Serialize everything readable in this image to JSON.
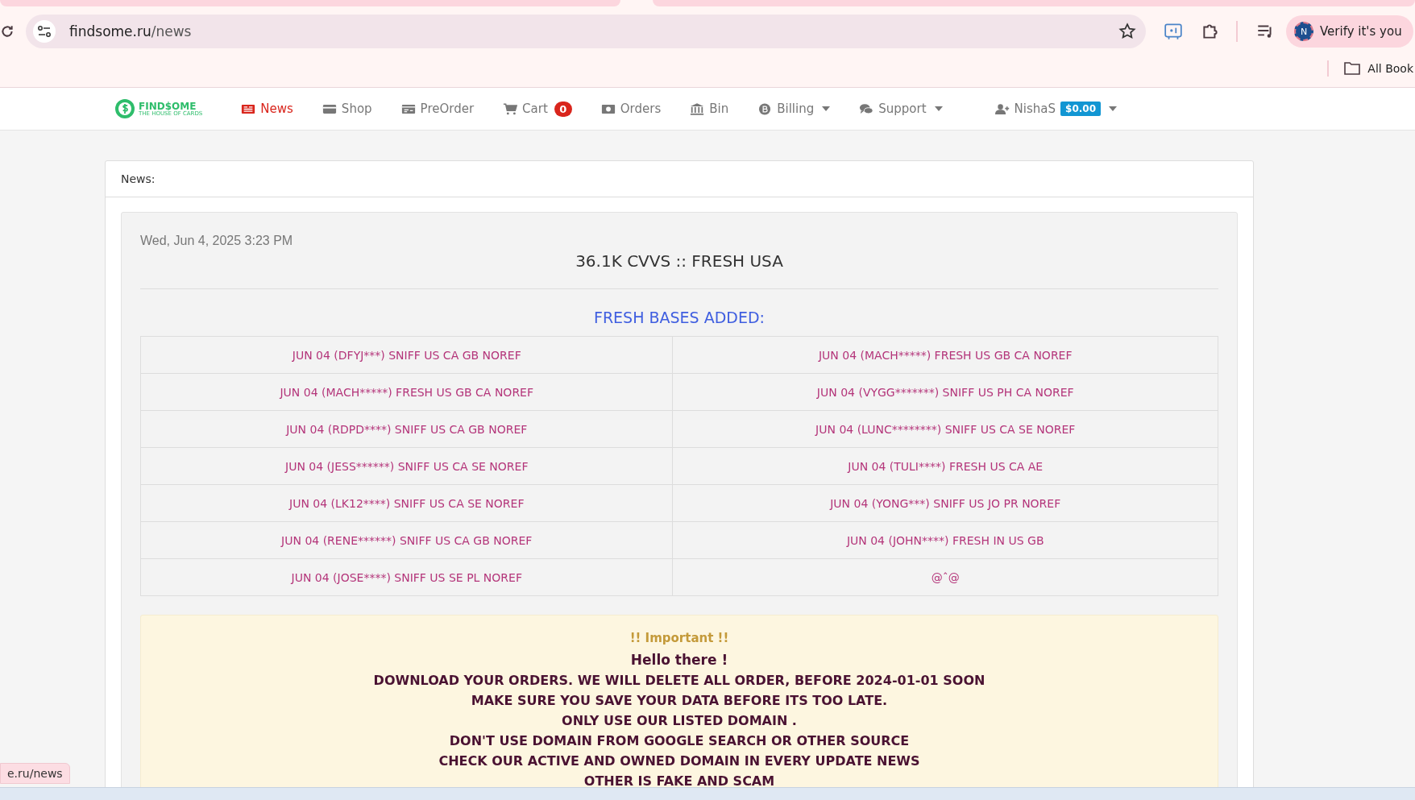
{
  "browser": {
    "url_host": "findsome.ru",
    "url_path": "/news",
    "profile_initial": "N",
    "profile_label": "Verify it's you",
    "bookmarks_label": "All Book",
    "status_url": "e.ru/news"
  },
  "site": {
    "logo_title": "FIND$OME",
    "logo_tagline": "THE HOUSE OF CARDS",
    "nav": [
      {
        "kind": "news",
        "label": "News",
        "selected": true,
        "has_menu": false
      },
      {
        "kind": "shop",
        "label": "Shop",
        "selected": false,
        "has_menu": false
      },
      {
        "kind": "preorder",
        "label": "PreOrder",
        "selected": false,
        "has_menu": false
      },
      {
        "kind": "cart",
        "label": "Cart",
        "selected": false,
        "has_menu": false,
        "badge": "0"
      },
      {
        "kind": "orders",
        "label": "Orders",
        "selected": false,
        "has_menu": false
      },
      {
        "kind": "bin",
        "label": "Bin",
        "selected": false,
        "has_menu": false
      },
      {
        "kind": "billing",
        "label": "Billing",
        "selected": false,
        "has_menu": true
      },
      {
        "kind": "support",
        "label": "Support",
        "selected": false,
        "has_menu": true
      }
    ],
    "user": {
      "name": "NishaS",
      "balance": "$0.00"
    }
  },
  "panel": {
    "heading": "News:",
    "post": {
      "date": "Wed, Jun 4, 2025 3:23 PM",
      "title": "36.1K CVVS :: FRESH USA",
      "subheading": "FRESH BASES ADDED:",
      "rows": [
        [
          "JUN 04 (DFYJ***) SNIFF US CA GB NOREF",
          "JUN 04 (MACH*****) FRESH US GB CA NOREF"
        ],
        [
          "JUN 04 (MACH*****) FRESH US GB CA NOREF",
          "JUN 04 (VYGG*******) SNIFF US PH CA NOREF"
        ],
        [
          "JUN 04 (RDPD****) SNIFF US CA GB NOREF",
          "JUN 04 (LUNC********) SNIFF US CA SE NOREF"
        ],
        [
          "JUN 04 (JESS******) SNIFF US CA SE NOREF",
          "JUN 04 (TULI****) FRESH US CA AE"
        ],
        [
          "JUN 04 (LK12****) SNIFF US CA SE NOREF",
          "JUN 04 (YONG***) SNIFF US JO PR NOREF"
        ],
        [
          "JUN 04 (RENE******) SNIFF US CA GB NOREF",
          "JUN 04 (JOHN****) FRESH IN US GB"
        ],
        [
          "JUN 04 (JOSE****) SNIFF US SE PL NOREF",
          "@ˆ@"
        ]
      ],
      "notice": {
        "title": "!! Important !!",
        "greeting": "Hello there !",
        "lines": [
          "DOWNLOAD YOUR ORDERS. WE WILL DELETE ALL ORDER, BEFORE 2024-01-01 SOON",
          "MAKE SURE YOU SAVE YOUR DATA BEFORE ITS TOO LATE.",
          "ONLY USE OUR LISTED DOMAIN .",
          "DON'T USE DOMAIN FROM GOOGLE SEARCH OR OTHER SOURCE",
          "CHECK OUR ACTIVE AND OWNED DOMAIN IN EVERY UPDATE NEWS",
          "OTHER IS FAKE AND SCAM"
        ]
      }
    }
  }
}
